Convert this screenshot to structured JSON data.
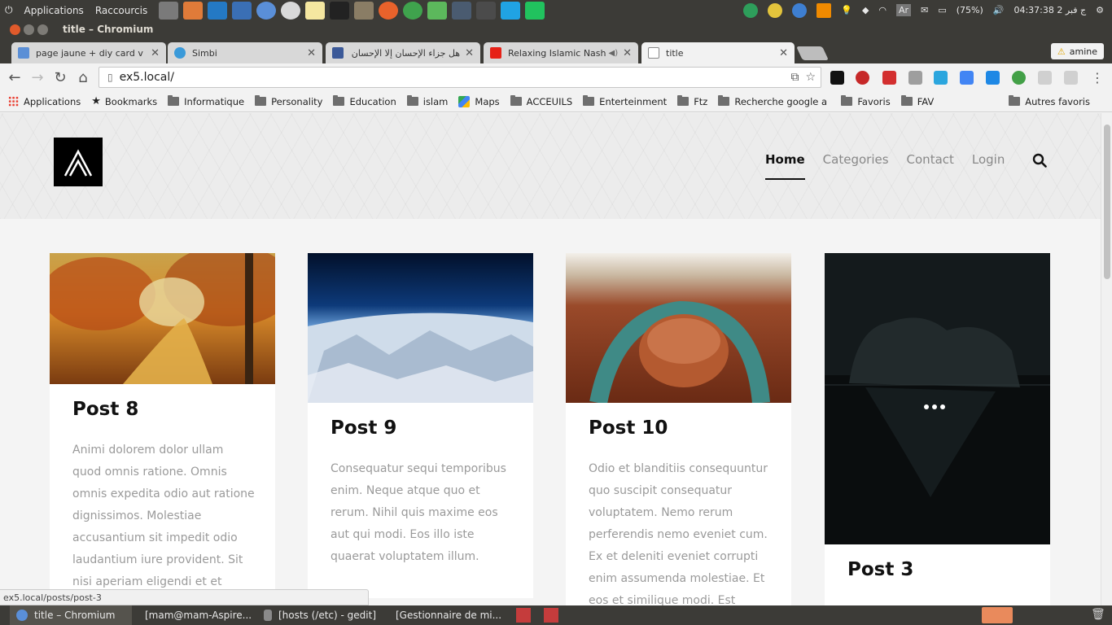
{
  "top_panel": {
    "menu_applications": "Applications",
    "menu_shortcuts": "Raccourcis",
    "battery": "(75%)",
    "clock": "ج فبر 2 04:37:38",
    "keyboard": "Ar"
  },
  "window": {
    "title": "title – Chromium"
  },
  "tabs": [
    {
      "label": "page jaune + diy card v + w"
    },
    {
      "label": "Simbi"
    },
    {
      "label": "هل جزاء الإحسان إلا الإحسان"
    },
    {
      "label": "Relaxing Islamic Nashe"
    },
    {
      "label": "title"
    }
  ],
  "profile": {
    "name": "amine"
  },
  "omnibox": {
    "url": "ex5.local/"
  },
  "bookmarks": {
    "items": [
      "Applications",
      "Bookmarks",
      "Informatique",
      "Personality",
      "Education",
      "islam",
      "Maps",
      "ACCEUILS",
      "Enterteinment",
      "Ftz",
      "Recherche google a b",
      "Favoris",
      "FAV"
    ],
    "other": "Autres favoris"
  },
  "site": {
    "nav": [
      "Home",
      "Categories",
      "Contact",
      "Login"
    ],
    "cards": [
      {
        "title": "Post 8",
        "body": "Animi dolorem dolor ullam quod omnis ratione. Omnis omnis expedita odio aut ratione dignissimos. Molestiae accusantium sit impedit odio laudantium iure provident. Sit nisi aperiam eligendi et et"
      },
      {
        "title": "Post 9",
        "body": "Consequatur sequi temporibus enim. Neque atque quo et rerum. Nihil quis maxime eos aut qui modi. Eos illo iste quaerat voluptatem illum."
      },
      {
        "title": "Post 10",
        "body": "Odio et blanditiis consequuntur quo suscipit consequatur voluptatem. Nemo rerum perferendis nemo eveniet cum. Ex et deleniti eveniet corrupti enim assumenda molestiae. Et eos et similique modi. Est"
      },
      {
        "title": "Post 3",
        "body": ""
      }
    ]
  },
  "status_bar": {
    "url": "ex5.local/posts/post-3"
  },
  "taskbar": [
    {
      "label": "title – Chromium"
    },
    {
      "label": "[mam@mam-Aspire..."
    },
    {
      "label": "[hosts (/etc) - gedit]"
    },
    {
      "label": "[Gestionnaire de mi..."
    }
  ],
  "colors": {
    "panel": "#3c3b37",
    "nav_active": "#111111",
    "nav_inactive": "#888888",
    "body_text": "#9a9a9a"
  }
}
